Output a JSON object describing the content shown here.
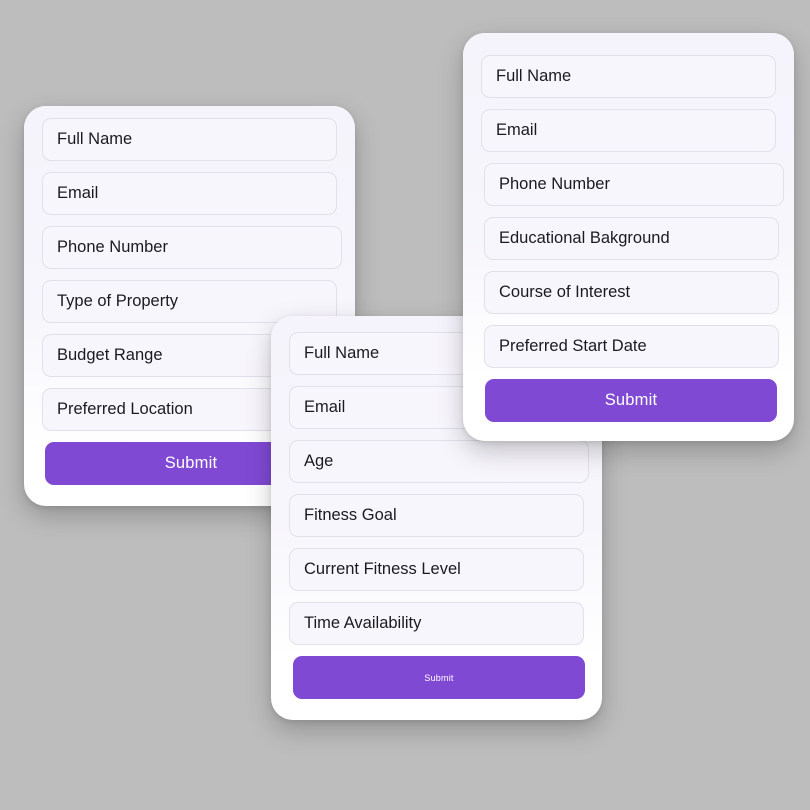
{
  "page": {
    "background_color": "#bdbdbd",
    "accent_color": "#8049d4",
    "card_background": "#ffffff",
    "field_background": "#f7f6fc"
  },
  "cards": [
    {
      "id": "real-estate-inquiry-form",
      "fields": [
        {
          "label": "Full Name"
        },
        {
          "label": "Email"
        },
        {
          "label": "Phone Number"
        },
        {
          "label": "Type of Property"
        },
        {
          "label": "Budget Range"
        },
        {
          "label": "Preferred Location"
        }
      ],
      "submit_label": "Submit"
    },
    {
      "id": "fitness-signup-form",
      "fields": [
        {
          "label": "Full Name"
        },
        {
          "label": "Email"
        },
        {
          "label": "Age"
        },
        {
          "label": "Fitness Goal"
        },
        {
          "label": "Current Fitness Level"
        },
        {
          "label": "Time Availability"
        }
      ],
      "submit_label": "Submit"
    },
    {
      "id": "course-enrollment-form",
      "fields": [
        {
          "label": "Full Name"
        },
        {
          "label": "Email"
        },
        {
          "label": "Phone Number"
        },
        {
          "label": "Educational Bakground"
        },
        {
          "label": "Course of Interest"
        },
        {
          "label": "Preferred Start Date"
        }
      ],
      "submit_label": "Submit"
    }
  ]
}
